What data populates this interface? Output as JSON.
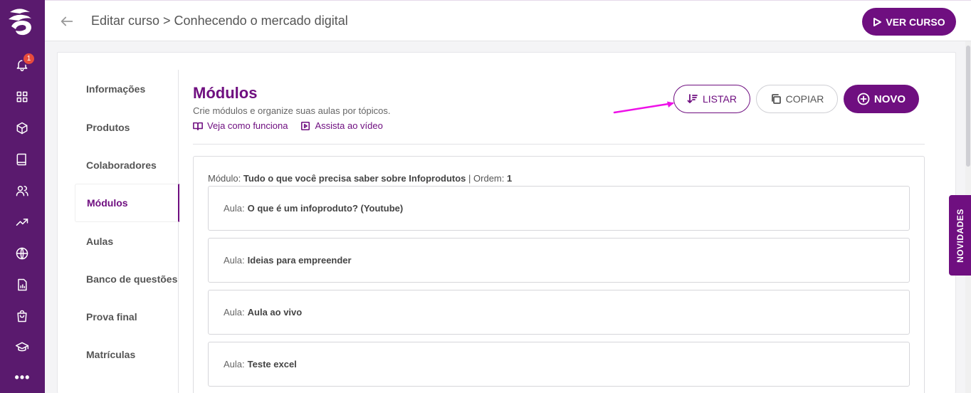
{
  "rail": {
    "notification_count": "1",
    "more_label": "•••"
  },
  "header": {
    "breadcrumb": "Editar curso > Conhecendo o mercado digital",
    "ver_curso_label": "VER CURSO"
  },
  "subnav": {
    "items": [
      {
        "label": "Informações"
      },
      {
        "label": "Produtos"
      },
      {
        "label": "Colaboradores"
      },
      {
        "label": "Módulos"
      },
      {
        "label": "Aulas"
      },
      {
        "label": "Banco de questões"
      },
      {
        "label": "Prova final"
      },
      {
        "label": "Matrículas"
      }
    ],
    "active": "Módulos"
  },
  "content": {
    "title": "Módulos",
    "subtitle": "Crie módulos e organize suas aulas por tópicos.",
    "link_veja": "Veja como funciona",
    "link_assista": "Assista ao vídeo",
    "listar_label": "LISTAR",
    "copiar_label": "COPIAR",
    "novo_label": "NOVO"
  },
  "module": {
    "prefix": "Módulo:",
    "name": "Tudo o que você precisa saber sobre Infoprodutos",
    "order_prefix": "| Ordem:",
    "order": "1",
    "lesson_prefix": "Aula:",
    "lessons": [
      {
        "title": "O que é um infoproduto? (Youtube)"
      },
      {
        "title": "Ideias para empreender"
      },
      {
        "title": "Aula ao vivo"
      },
      {
        "title": "Teste excel"
      }
    ]
  },
  "novidades_label": "NOVIDADES",
  "colors": {
    "primary": "#6f0f80",
    "rail": "#5a1a6e",
    "annotation_arrow": "#ee10e8",
    "badge": "#e74c3c"
  }
}
